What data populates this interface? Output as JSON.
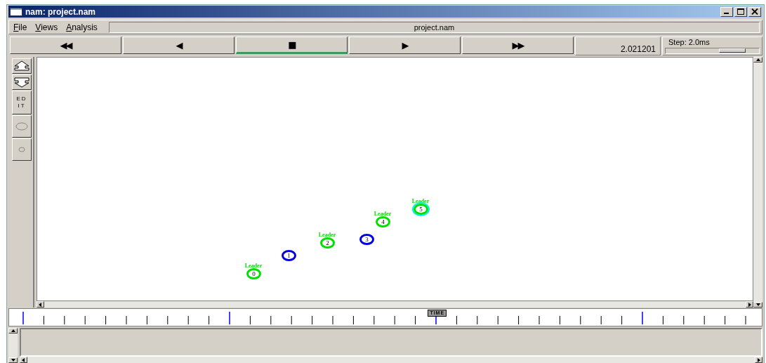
{
  "window": {
    "title": "nam: project.nam"
  },
  "menu": [
    {
      "label": "File"
    },
    {
      "label": "Views"
    },
    {
      "label": "Analysis"
    }
  ],
  "file_name": "project.nam",
  "controls": [
    {
      "symbol": "◀◀",
      "selected": false
    },
    {
      "symbol": "◀",
      "selected": false
    },
    {
      "symbol": "■",
      "selected": true
    },
    {
      "symbol": "▶",
      "selected": false
    },
    {
      "symbol": "▶▶",
      "selected": false
    }
  ],
  "time": "2.021201",
  "step": {
    "label": "Step: 2.0ms",
    "level": 0.72
  },
  "tools": [
    {
      "kind": "zoom-in"
    },
    {
      "kind": "zoom-out"
    },
    {
      "kind": "edit",
      "label": "ED IT"
    },
    {
      "kind": "big-node"
    },
    {
      "kind": "small-node"
    }
  ],
  "nodes": [
    {
      "id": "0",
      "label": "Leader",
      "color": "#00e000",
      "highlighted": false
    },
    {
      "id": "1",
      "color": "#0000e0",
      "highlighted": false
    },
    {
      "id": "2",
      "label": "Leader",
      "color": "#00e000",
      "highlighted": false
    },
    {
      "id": "3",
      "color": "#0000e0",
      "highlighted": false
    },
    {
      "id": "4",
      "label": "Leader",
      "color": "#00e000",
      "highlighted": false
    },
    {
      "id": "5",
      "label": "Leader",
      "color": "#00e000",
      "highlighted": true
    }
  ],
  "timeline": {
    "marker": "TIME",
    "level": 0.575
  }
}
